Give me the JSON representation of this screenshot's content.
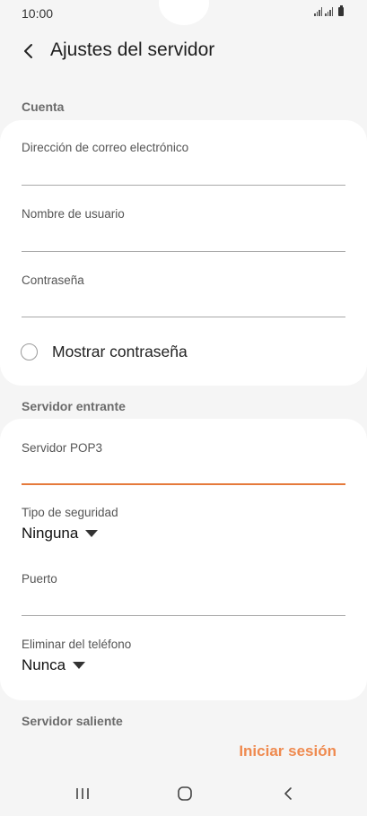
{
  "status_bar": {
    "time": "10:00"
  },
  "header": {
    "title": "Ajustes del servidor"
  },
  "account": {
    "section_label": "Cuenta",
    "email_label": "Dirección de correo electrónico",
    "username_label": "Nombre de usuario",
    "password_label": "Contraseña",
    "show_password_label": "Mostrar contraseña"
  },
  "incoming": {
    "section_label": "Servidor entrante",
    "pop3_label": "Servidor POP3",
    "security_label": "Tipo de seguridad",
    "security_value": "Ninguna",
    "port_label": "Puerto",
    "delete_label": "Eliminar del teléfono",
    "delete_value": "Nunca"
  },
  "outgoing": {
    "section_label": "Servidor saliente"
  },
  "actions": {
    "signin_label": "Iniciar sesión"
  },
  "colors": {
    "accent": "#ef8a4f",
    "active_line": "#e57a3b",
    "background": "#f5f5f5",
    "card": "#ffffff"
  },
  "icons": [
    "back-arrow-icon",
    "signal-icon",
    "battery-icon",
    "recents-icon",
    "home-icon",
    "nav-back-icon",
    "caret-down-icon"
  ]
}
